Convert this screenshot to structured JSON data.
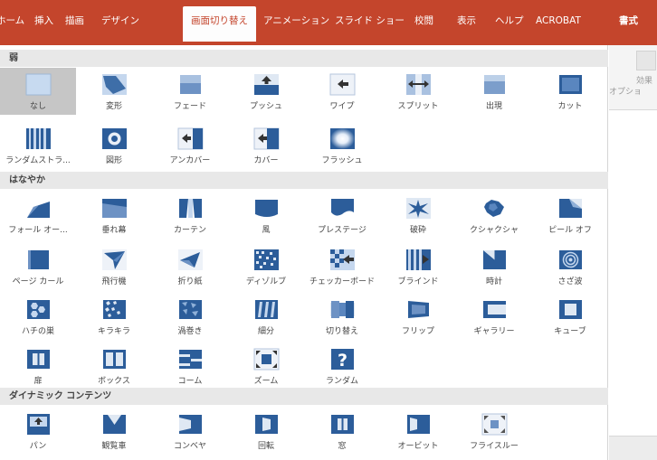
{
  "ribbon": {
    "tabs": [
      "ホーム",
      "挿入",
      "描画",
      "デザイン",
      "画面切り替え",
      "アニメーション",
      "スライド ショー",
      "校閲",
      "表示",
      "ヘルプ",
      "ACROBAT",
      "書式"
    ],
    "active_tab": "画面切り替え",
    "color": "#c4452c"
  },
  "gallery": {
    "sections": [
      {
        "title": "弱",
        "items": [
          {
            "label": "なし",
            "icon": "none-transition-icon",
            "selected": true
          },
          {
            "label": "変形",
            "icon": "morph-transition-icon"
          },
          {
            "label": "フェード",
            "icon": "fade-transition-icon"
          },
          {
            "label": "プッシュ",
            "icon": "push-transition-icon"
          },
          {
            "label": "ワイプ",
            "icon": "wipe-transition-icon"
          },
          {
            "label": "スプリット",
            "icon": "split-transition-icon"
          },
          {
            "label": "出現",
            "icon": "reveal-transition-icon"
          },
          {
            "label": "カット",
            "icon": "cut-transition-icon"
          },
          {
            "label": "ランダムストラ...",
            "icon": "random-bars-transition-icon"
          },
          {
            "label": "図形",
            "icon": "shape-transition-icon"
          },
          {
            "label": "アンカバー",
            "icon": "uncover-transition-icon"
          },
          {
            "label": "カバー",
            "icon": "cover-transition-icon"
          },
          {
            "label": "フラッシュ",
            "icon": "flash-transition-icon"
          }
        ]
      },
      {
        "title": "はなやか",
        "items": [
          {
            "label": "フォール オー...",
            "icon": "fall-over-transition-icon"
          },
          {
            "label": "垂れ幕",
            "icon": "drape-transition-icon"
          },
          {
            "label": "カーテン",
            "icon": "curtains-transition-icon"
          },
          {
            "label": "風",
            "icon": "wind-transition-icon"
          },
          {
            "label": "プレステージ",
            "icon": "prestige-transition-icon"
          },
          {
            "label": "破砕",
            "icon": "fracture-transition-icon"
          },
          {
            "label": "クシャクシャ",
            "icon": "crush-transition-icon"
          },
          {
            "label": "ピール オフ",
            "icon": "peel-off-transition-icon"
          },
          {
            "label": "ページ カール",
            "icon": "page-curl-transition-icon"
          },
          {
            "label": "飛行機",
            "icon": "airplane-transition-icon"
          },
          {
            "label": "折り紙",
            "icon": "origami-transition-icon"
          },
          {
            "label": "ディゾルブ",
            "icon": "dissolve-transition-icon"
          },
          {
            "label": "チェッカーボード",
            "icon": "checkerboard-transition-icon"
          },
          {
            "label": "ブラインド",
            "icon": "blinds-transition-icon"
          },
          {
            "label": "時計",
            "icon": "clock-transition-icon"
          },
          {
            "label": "さざ波",
            "icon": "ripple-transition-icon"
          },
          {
            "label": "ハチの巣",
            "icon": "honeycomb-transition-icon"
          },
          {
            "label": "キラキラ",
            "icon": "glitter-transition-icon"
          },
          {
            "label": "渦巻き",
            "icon": "vortex-transition-icon"
          },
          {
            "label": "細分",
            "icon": "shred-transition-icon"
          },
          {
            "label": "切り替え",
            "icon": "switch-transition-icon"
          },
          {
            "label": "フリップ",
            "icon": "flip-transition-icon"
          },
          {
            "label": "ギャラリー",
            "icon": "gallery-transition-icon"
          },
          {
            "label": "キューブ",
            "icon": "cube-transition-icon"
          },
          {
            "label": "扉",
            "icon": "doors-transition-icon"
          },
          {
            "label": "ボックス",
            "icon": "box-transition-icon"
          },
          {
            "label": "コーム",
            "icon": "comb-transition-icon"
          },
          {
            "label": "ズーム",
            "icon": "zoom-transition-icon"
          },
          {
            "label": "ランダム",
            "icon": "random-transition-icon"
          }
        ]
      },
      {
        "title": "ダイナミック コンテンツ",
        "items": [
          {
            "label": "パン",
            "icon": "pan-transition-icon"
          },
          {
            "label": "観覧車",
            "icon": "ferris-wheel-transition-icon"
          },
          {
            "label": "コンベヤ",
            "icon": "conveyor-transition-icon"
          },
          {
            "label": "回転",
            "icon": "rotate-transition-icon"
          },
          {
            "label": "窓",
            "icon": "window-transition-icon"
          },
          {
            "label": "オービット",
            "icon": "orbit-transition-icon"
          },
          {
            "label": "フライスルー",
            "icon": "fly-through-transition-icon"
          }
        ]
      }
    ]
  },
  "side_panel": {
    "effect_options_label_line1": "効果",
    "effect_options_label_line2": "オプショ"
  }
}
